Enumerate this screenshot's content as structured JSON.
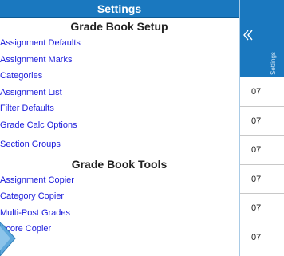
{
  "settings": {
    "title": "Settings",
    "setup_heading": "Grade Book Setup",
    "setup_links": [
      "Assignment Defaults",
      "Assignment Marks",
      "Categories",
      "Assignment List",
      "Filter Defaults",
      "Grade Calc Options",
      "Section Groups"
    ],
    "tools_heading": "Grade Book Tools",
    "tools_links": [
      "Assignment Copier",
      "Category Copier",
      "Multi-Post Grades",
      "Score Copier"
    ]
  },
  "background": {
    "header_vertical_text": "Settings",
    "row_values": [
      "07",
      "07",
      "07",
      "07",
      "07",
      "07"
    ]
  },
  "colors": {
    "header_blue": "#1a78bf",
    "link_blue": "#1a1adb",
    "pointer_blue": "#5ea8dc"
  },
  "icons": {
    "collapse": "double-chevron-left-icon",
    "pointer": "pointer-arrow-icon"
  }
}
